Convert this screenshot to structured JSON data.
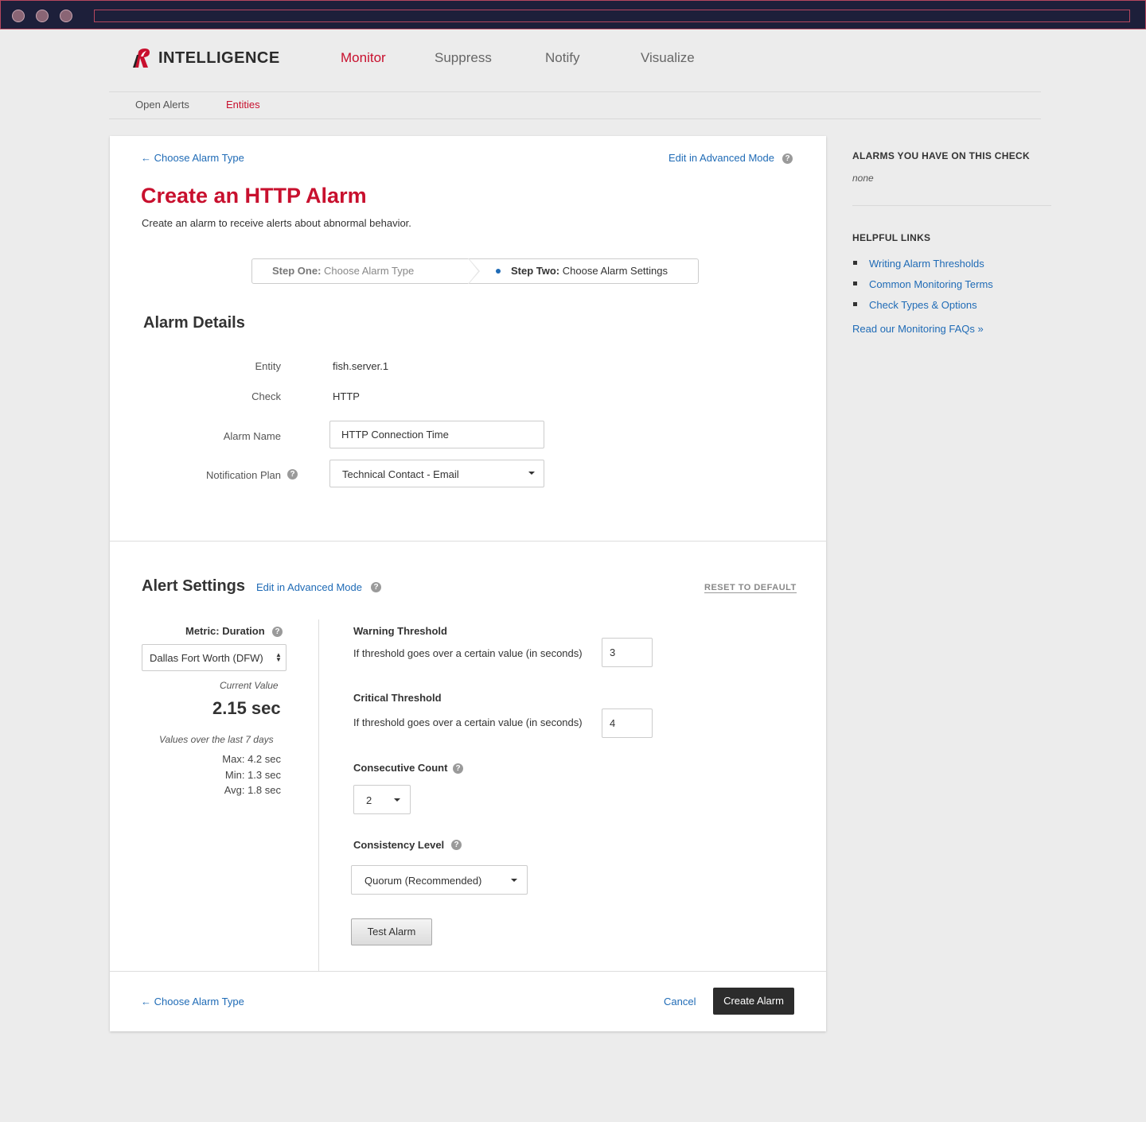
{
  "brand": {
    "name": "INTELLIGENCE",
    "accent": "#c8102e",
    "link_color": "#1f6bb6"
  },
  "main_nav": [
    "Monitor",
    "Suppress",
    "Notify",
    "Visualize"
  ],
  "sub_nav": [
    "Open Alerts",
    "Entities"
  ],
  "page": {
    "back_link": "← Choose Alarm Type",
    "advanced_link": "Edit in Advanced Mode",
    "title": "Create an HTTP Alarm",
    "lead": "Create an alarm to receive alerts about abnormal behavior."
  },
  "steps": {
    "one_label": "Step One:",
    "one_text": "Choose Alarm Type",
    "two_label": "Step Two:",
    "two_text": "Choose Alarm Settings"
  },
  "alarm_details": {
    "title": "Alarm Details",
    "entity_label": "Entity",
    "entity_value": "fish.server.1",
    "check_label": "Check",
    "check_value": "HTTP",
    "name_label": "Alarm Name",
    "name_value": "HTTP Connection Time",
    "plan_label": "Notification Plan",
    "plan_value": "Technical Contact - Email"
  },
  "alert_settings": {
    "title": "Alert Settings",
    "advanced_link": "Edit in Advanced Mode",
    "reset": "RESET TO DEFAULT",
    "metric_label": "Metric: Duration",
    "region": "Dallas Fort Worth (DFW)",
    "current_label": "Current Value",
    "current_value": "2.15 sec",
    "history_label": "Values over the last 7 days",
    "max": "Max: 4.2 sec",
    "min": "Min: 1.3 sec",
    "avg": "Avg: 1.8 sec",
    "warning_title": "Warning Threshold",
    "warning_desc": "If threshold goes over a certain value (in seconds)",
    "warning_value": "3",
    "critical_title": "Critical Threshold",
    "critical_desc": "If threshold goes over a certain value (in seconds)",
    "critical_value": "4",
    "consecutive_title": "Consecutive Count",
    "consecutive_value": "2",
    "consistency_title": "Consistency Level",
    "consistency_value": "Quorum (Recommended)",
    "test_button": "Test Alarm"
  },
  "footer": {
    "back_link": "← Choose Alarm Type",
    "cancel": "Cancel",
    "create": "Create Alarm"
  },
  "sidebar": {
    "alarms_heading": "ALARMS YOU HAVE ON THIS CHECK",
    "alarms_none": "none",
    "links_heading": "HELPFUL LINKS",
    "links": [
      "Writing Alarm Thresholds",
      "Common Monitoring Terms",
      "Check Types & Options"
    ],
    "faq": "Read our Monitoring FAQs »"
  },
  "icons": {
    "help": "question-circle-icon",
    "logo": "rackspace-logo-icon"
  }
}
